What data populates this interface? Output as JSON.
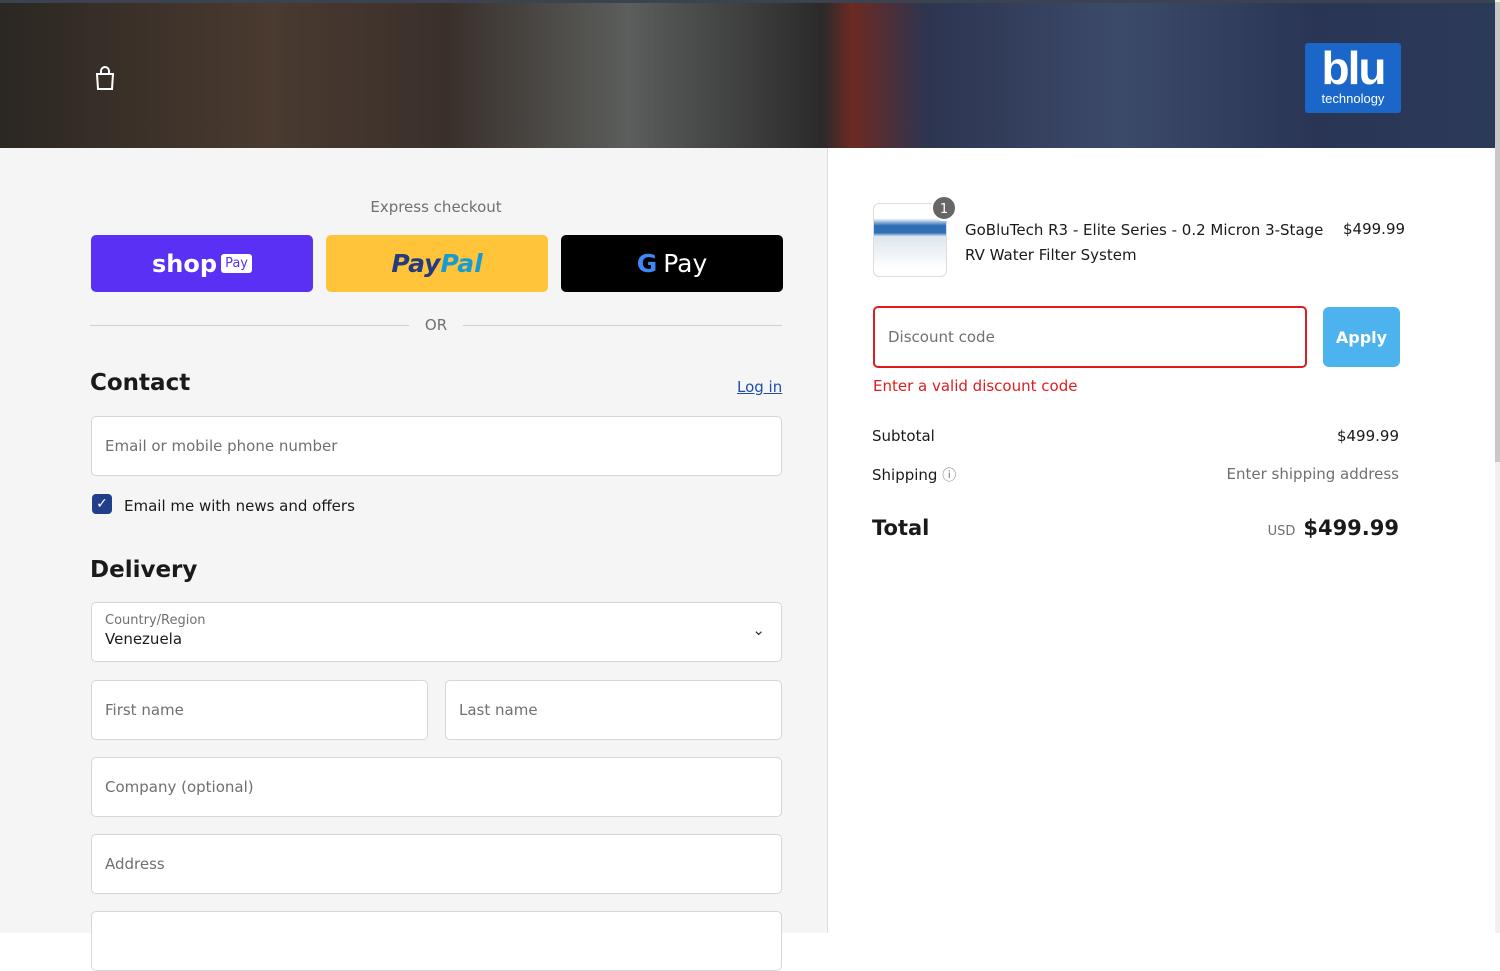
{
  "header": {
    "brand_logo": "blu technology",
    "logo_main": "blu",
    "logo_sub": "technology"
  },
  "express": {
    "title": "Express checkout",
    "shop_pay": "shop",
    "shop_pay_badge": "Pay",
    "paypal_a": "Pay",
    "paypal_b": "Pal",
    "gpay": "Pay",
    "or": "OR"
  },
  "contact": {
    "title": "Contact",
    "login": "Log in",
    "email_placeholder": "Email or mobile phone number",
    "newsletter": "Email me with news and offers",
    "newsletter_checked": true
  },
  "delivery": {
    "title": "Delivery",
    "country_label": "Country/Region",
    "country_value": "Venezuela",
    "first_name": "First name",
    "last_name": "Last name",
    "company": "Company (optional)",
    "address": "Address"
  },
  "summary": {
    "item": {
      "qty": "1",
      "name_line1": "GoBluTech R3 - Elite Series - 0.2 Micron 3-Stage",
      "name_line2": "RV Water Filter System",
      "price": "$499.99"
    },
    "discount_placeholder": "Discount code",
    "apply": "Apply",
    "error": "Enter a valid discount code",
    "subtotal_label": "Subtotal",
    "subtotal": "$499.99",
    "shipping_label": "Shipping",
    "shipping_value": "Enter shipping address",
    "total_label": "Total",
    "currency": "USD",
    "total": "$499.99"
  },
  "colors": {
    "shop_pay": "#5a31f4",
    "paypal": "#ffc439",
    "error": "#dd1d1d",
    "apply": "#4db3ee"
  }
}
